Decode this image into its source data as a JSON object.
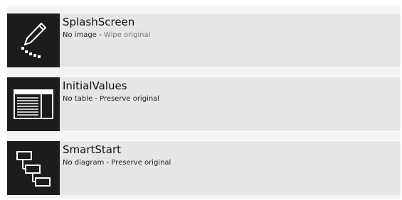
{
  "items": [
    {
      "title": "SplashScreen",
      "status": "No image",
      "separator": " - ",
      "action": "Wipe original",
      "icon": "pencil-icon"
    },
    {
      "title": "InitialValues",
      "status": "No table",
      "separator": " - ",
      "action": "Preserve original",
      "icon": "table-icon"
    },
    {
      "title": "SmartStart",
      "status": "No diagram",
      "separator": " - ",
      "action": "Preserve original",
      "icon": "diagram-icon"
    }
  ],
  "colors": {
    "tile_background": "#1c1c1c",
    "row_background": "#e6e6e6",
    "muted_text": "#777777"
  }
}
